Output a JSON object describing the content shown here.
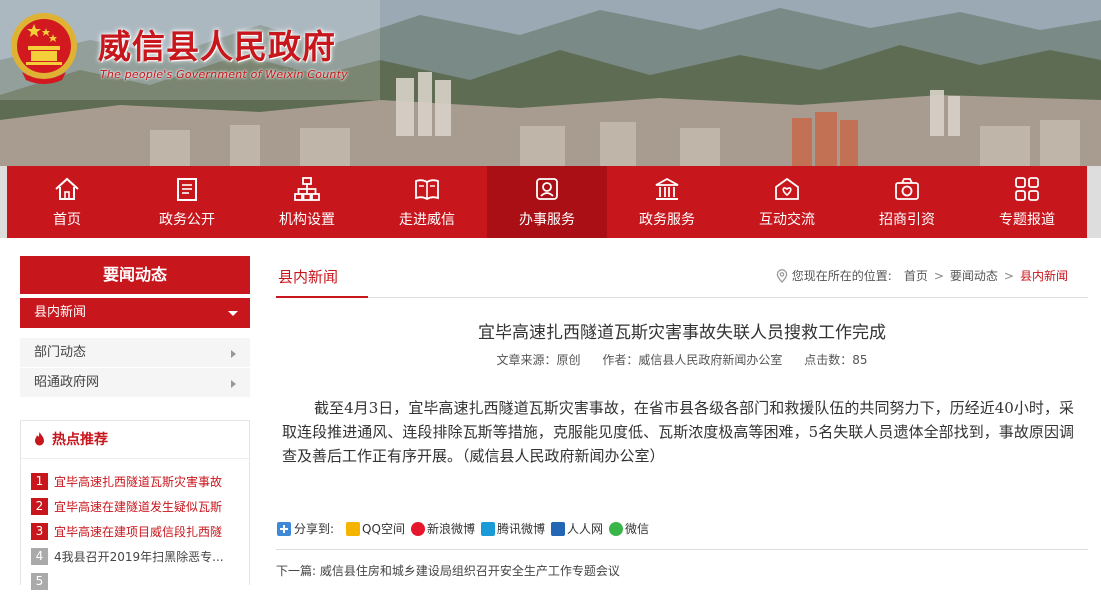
{
  "header": {
    "title": "威信县人民政府",
    "subtitle": "The people's Government of Weixin County"
  },
  "nav": {
    "items": [
      {
        "label": "首页",
        "icon": "home-icon"
      },
      {
        "label": "政务公开",
        "icon": "document-icon"
      },
      {
        "label": "机构设置",
        "icon": "org-chart-icon"
      },
      {
        "label": "走进威信",
        "icon": "book-icon"
      },
      {
        "label": "办事服务",
        "icon": "service-icon",
        "active": true
      },
      {
        "label": "政务服务",
        "icon": "building-icon"
      },
      {
        "label": "互动交流",
        "icon": "interaction-icon"
      },
      {
        "label": "招商引资",
        "icon": "camera-icon"
      },
      {
        "label": "专题报道",
        "icon": "grid-icon"
      }
    ]
  },
  "sidebar": {
    "heading": "要闻动态",
    "current": "县内新闻",
    "links": [
      "部门动态",
      "昭通政府网"
    ],
    "hot": {
      "heading": "热点推荐",
      "items": [
        {
          "num": "1",
          "text": "宜毕高速扎西隧道瓦斯灾害事故"
        },
        {
          "num": "2",
          "text": "宜毕高速在建隧道发生疑似瓦斯"
        },
        {
          "num": "3",
          "text": "宜毕高速在建项目威信段扎西隧"
        },
        {
          "num": "4",
          "text": "4我县召开2019年扫黑除恶专..."
        },
        {
          "num": "5",
          "text": ""
        }
      ]
    }
  },
  "main": {
    "tab": "县内新闻",
    "breadcrumb": {
      "prefix": "您现在所在的位置:",
      "items": [
        "首页",
        "要闻动态",
        "县内新闻"
      ],
      "separator": ">"
    },
    "article": {
      "title": "宜毕高速扎西隧道瓦斯灾害事故失联人员搜救工作完成",
      "source": "文章来源：原创",
      "author": "作者：威信县人民政府新闻办公室",
      "clicks": "点击数：85",
      "body": "截至4月3日，宜毕高速扎西隧道瓦斯灾害事故，在省市县各级各部门和救援队伍的共同努力下，历经近40小时，采取连段推进通风、连段排除瓦斯等措施，克服能见度低、瓦斯浓度极高等困难，5名失联人员遗体全部找到，事故原因调查及善后工作正有序开展。（威信县人民政府新闻办公室）"
    },
    "share": {
      "label": "分享到:",
      "items": [
        {
          "label": "QQ空间",
          "color": "#f5b400"
        },
        {
          "label": "新浪微博",
          "color": "#e6162d"
        },
        {
          "label": "腾讯微博",
          "color": "#1a9bd7"
        },
        {
          "label": "人人网",
          "color": "#2266b4"
        },
        {
          "label": "微信",
          "color": "#39b54a"
        }
      ]
    },
    "next": {
      "label": "下一篇:",
      "title": "威信县住房和城乡建设局组织召开安全生产工作专题会议"
    }
  },
  "colors": {
    "brand": "#c8161d",
    "brand_dark": "#a90f15"
  }
}
